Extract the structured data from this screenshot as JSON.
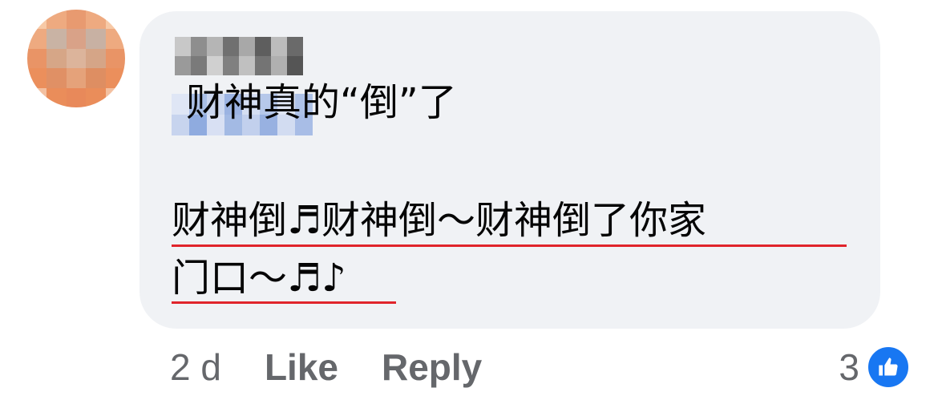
{
  "comment": {
    "author_name": "",
    "line1": "财神真的“倒”了",
    "line2": "财神倒♬财神倒～财神倒了你家",
    "line3": "门口～♬♪"
  },
  "actions": {
    "time": "2 d",
    "like_label": "Like",
    "reply_label": "Reply"
  },
  "reactions": {
    "count": "3",
    "icon": "thumbs-up-icon"
  },
  "colors": {
    "bubble": "#f0f2f5",
    "text": "#050505",
    "muted": "#65676b",
    "underline": "#e0242b",
    "like_badge": "#1877f2"
  }
}
